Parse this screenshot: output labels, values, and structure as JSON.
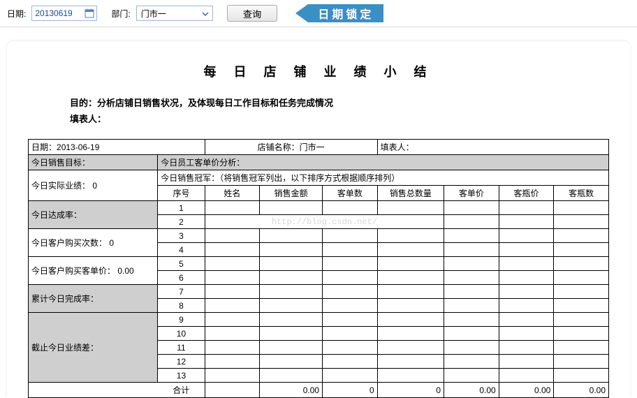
{
  "toolbar": {
    "date_label": "日期:",
    "date_value": "20130619",
    "dept_label": "部门:",
    "dept_value": "门市一",
    "search_btn": "查询",
    "badge": "日期锁定"
  },
  "title": "每 日 店 铺 业 绩 小 结",
  "purpose": "目的：分析店铺日销售状况，及体现每日工作目标和任务完成情况",
  "filler_label": "填表人：",
  "header_row": {
    "date_label": "日期：",
    "date_value": "2013-06-19",
    "store_label": "店铺名称：",
    "store_value": "门市一",
    "filler_label": "填表人：",
    "filler_value": ""
  },
  "left_rows": {
    "target": "今日销售目标：",
    "actual": "今日实际业绩：",
    "actual_val": "0",
    "rate": "今日达成率：",
    "cust": "今日客户购买次数：",
    "cust_val": "0",
    "unit": "今日客户购买客单价：",
    "unit_val": "0.00",
    "cum": "累计今日完成率：",
    "diff": "截止今日业绩差："
  },
  "right_top": {
    "analysis": "今日员工客单价分析：",
    "champ": "今日销售冠军：（将销售冠军列出，以下排序方式根据顺序排列）"
  },
  "columns": [
    "序号",
    "姓名",
    "销售金额",
    "客单数",
    "销售总数量",
    "客单价",
    "客瓶价",
    "客瓶数"
  ],
  "rows": [
    "1",
    "2",
    "3",
    "4",
    "5",
    "6",
    "7",
    "8",
    "9",
    "10",
    "11",
    "12",
    "13"
  ],
  "watermark": "http://blog.csdn.net/",
  "total_label": "合计",
  "totals": [
    "",
    "0.00",
    "0",
    "0",
    "0.00",
    "0.00",
    "0.00"
  ]
}
